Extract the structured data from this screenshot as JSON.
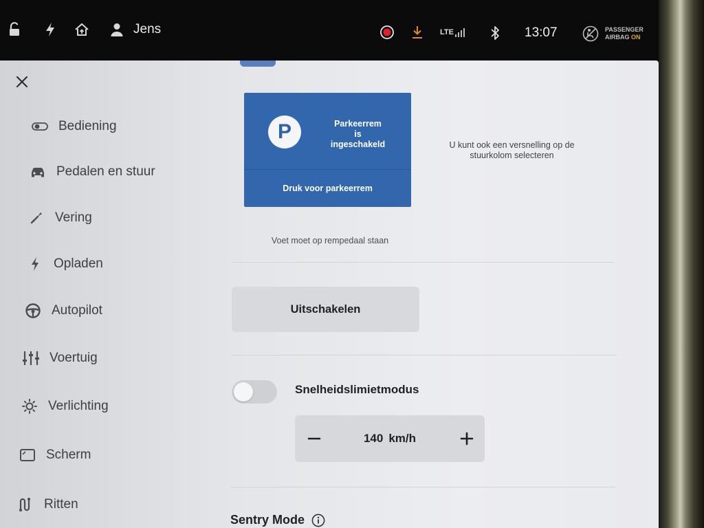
{
  "status_bar": {
    "user_name": "Jens",
    "lte_label": "LTE",
    "time": "13:07",
    "airbag_label_1": "PASSENGER",
    "airbag_label_2": "AIRBAG",
    "airbag_status": "ON"
  },
  "sidebar": {
    "items": [
      {
        "label": "Bediening",
        "icon": "toggle-icon"
      },
      {
        "label": "Pedalen en stuur",
        "icon": "car-icon"
      },
      {
        "label": "Vering",
        "icon": "wrench-icon"
      },
      {
        "label": "Opladen",
        "icon": "bolt-icon"
      },
      {
        "label": "Autopilot",
        "icon": "steering-wheel-icon"
      },
      {
        "label": "Voertuig",
        "icon": "sliders-icon"
      },
      {
        "label": "Verlichting",
        "icon": "sun-icon"
      },
      {
        "label": "Scherm",
        "icon": "display-icon"
      },
      {
        "label": "Ritten",
        "icon": "route-icon"
      }
    ]
  },
  "parking_brake": {
    "symbol": "P",
    "status_line1": "Parkeerrem",
    "status_line2": "is",
    "status_line3": "ingeschakeld",
    "button_label": "Druk voor parkeerrem",
    "gear_hint": "U kunt ook een versnelling op de stuurkolom selecteren",
    "foot_hint": "Voet moet op rempedaal staan"
  },
  "disengage_button": "Uitschakelen",
  "speed_limit": {
    "label": "Snelheidslimietmodus",
    "enabled": false,
    "value": "140",
    "unit": "km/h"
  },
  "sentry": {
    "label": "Sentry Mode"
  },
  "colors": {
    "accent_blue": "#3267ae",
    "record_red": "#e0202a",
    "download_orange": "#e08a2a",
    "airbag_on": "#e3a23b"
  }
}
